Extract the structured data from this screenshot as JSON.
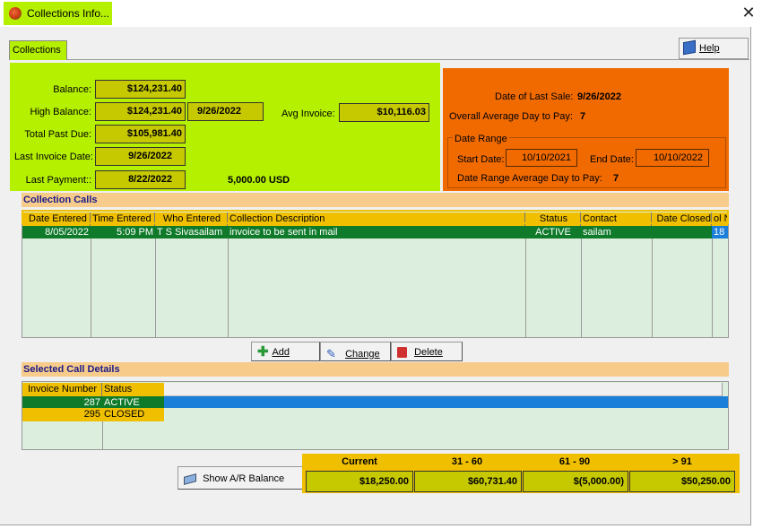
{
  "window": {
    "title": "Collections Info...",
    "close_glyph": "✕"
  },
  "tab": {
    "label": "Collections"
  },
  "help": {
    "label": "Help"
  },
  "summary": {
    "balance_label": "Balance:",
    "balance": "$124,231.40",
    "high_balance_label": "High Balance:",
    "high_balance": "$124,231.40",
    "high_balance_date": "9/26/2022",
    "avg_invoice_label": "Avg Invoice:",
    "avg_invoice": "$10,116.03",
    "total_past_due_label": "Total Past Due:",
    "total_past_due": "$105,981.40",
    "last_invoice_date_label": "Last Invoice Date:",
    "last_invoice_date": "9/26/2022",
    "last_payment_label": "Last Payment::",
    "last_payment_date": "8/22/2022",
    "last_payment_amount": "5,000.00  USD"
  },
  "sale": {
    "last_sale_label": "Date of Last Sale:",
    "last_sale": "9/26/2022",
    "overall_avg_label": "Overall Average Day to Pay:",
    "overall_avg": "7",
    "range_title": "Date Range",
    "start_label": "Start Date:",
    "start": "10/10/2021",
    "end_label": "End Date:",
    "end": "10/10/2022",
    "range_avg_label": "Date Range Average Day to Pay:",
    "range_avg": "7"
  },
  "calls": {
    "title": "Collection Calls",
    "headers": [
      "Date Entered",
      "Time Entered",
      "Who Entered",
      "Collection Description",
      "Status",
      "Contact",
      "Date Closed",
      "ol N"
    ],
    "rows": [
      [
        "8/05/2022",
        "5:09 PM",
        "T S Sivasailam",
        "invoice to be sent in mail",
        "ACTIVE",
        "sailam",
        "",
        "18"
      ]
    ]
  },
  "buttons": {
    "add": "Add",
    "change": "Change",
    "delete": "Delete",
    "show_ar": "Show A/R Balance"
  },
  "details": {
    "title": "Selected Call Details",
    "headers": [
      "Invoice Number",
      "Status"
    ],
    "rows": [
      [
        "287",
        "ACTIVE"
      ],
      [
        "295",
        "CLOSED"
      ]
    ]
  },
  "aging": {
    "headers": [
      "Current",
      "31 - 60",
      "61 - 90",
      "> 91"
    ],
    "values": [
      "$18,250.00",
      "$60,731.40",
      "$(5,000.00)",
      "$50,250.00"
    ]
  },
  "colors": {
    "lime": "#b5f000",
    "orange": "#f06a00",
    "gold": "#f0c000",
    "olive": "#c6c800",
    "row_green": "#0f7a2a",
    "row_blue": "#1a7fd8"
  }
}
